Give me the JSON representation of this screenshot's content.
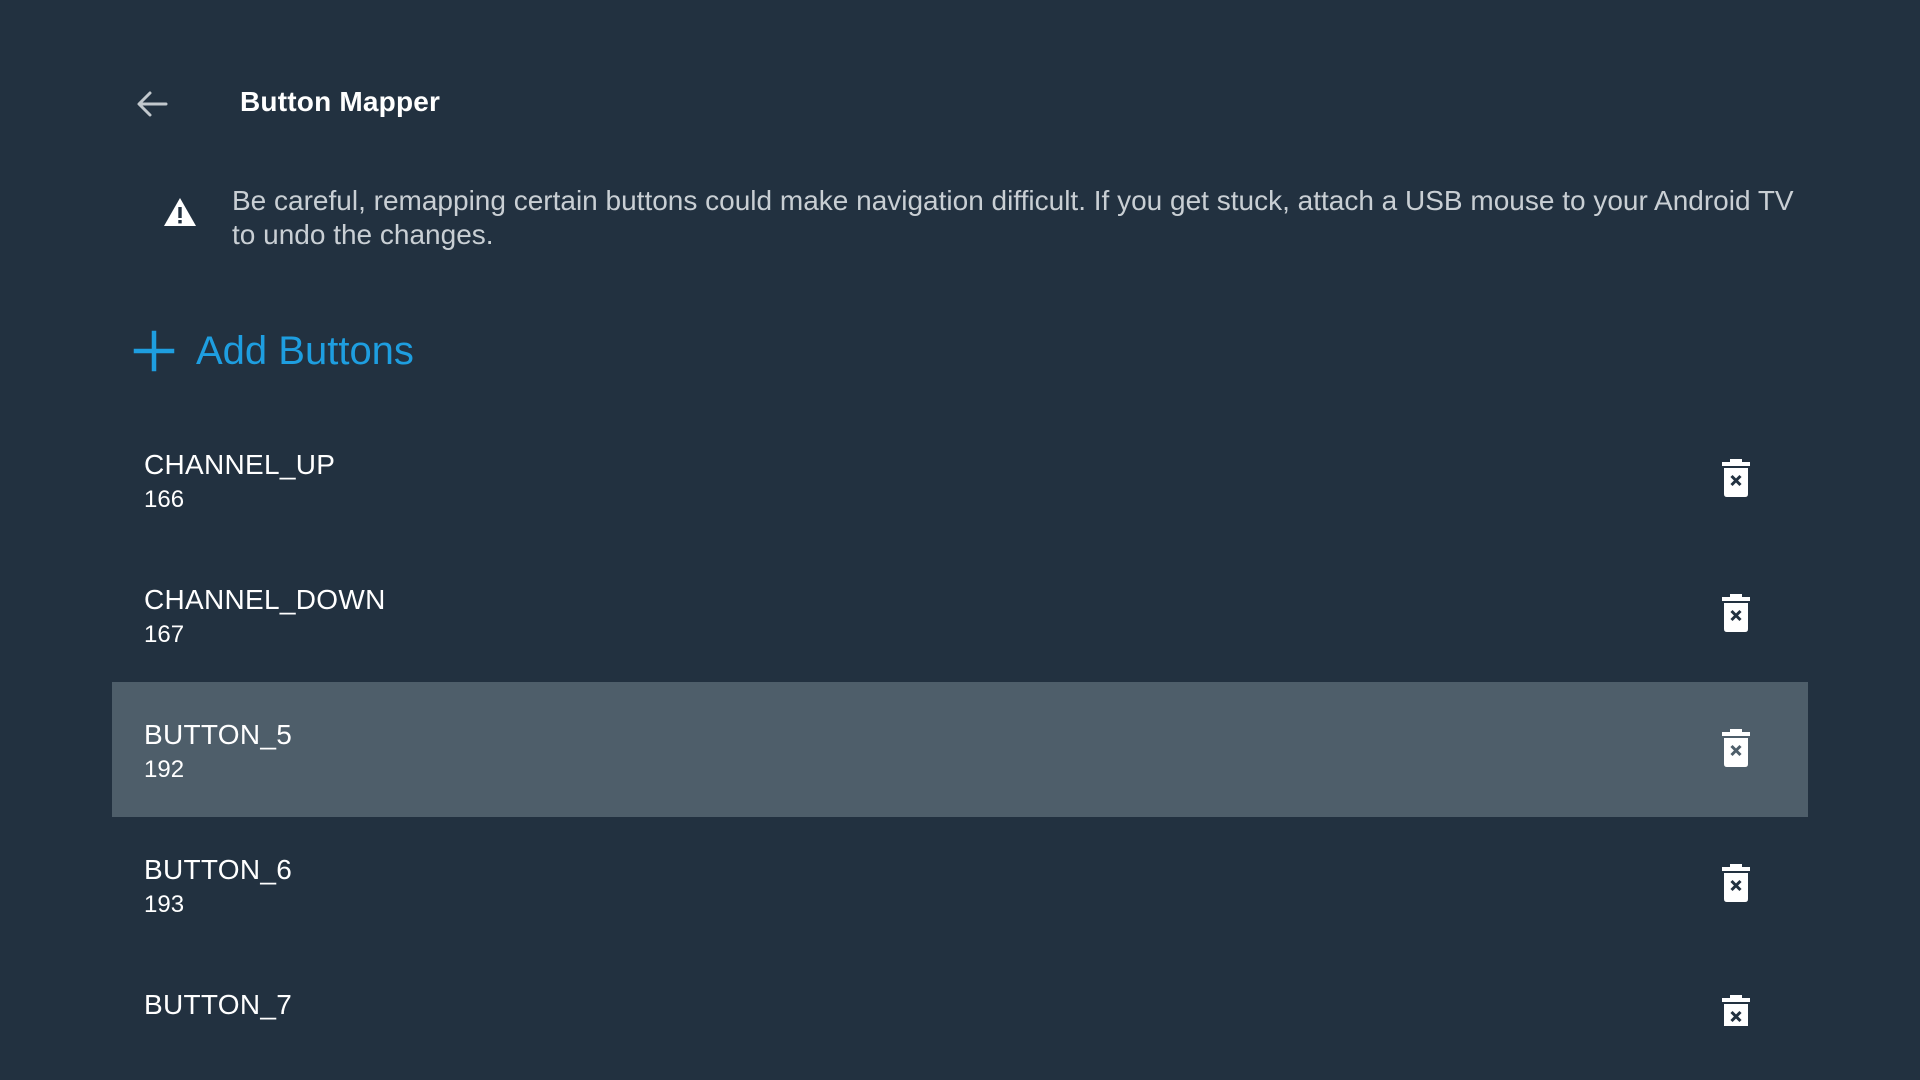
{
  "header": {
    "back_icon": "arrow-back-icon",
    "title": "Button Mapper"
  },
  "warning": {
    "icon": "warning-triangle-icon",
    "text": "Be careful, remapping certain buttons could make navigation difficult. If you get stuck, attach a USB mouse to your Android TV to undo the changes."
  },
  "add_buttons": {
    "icon": "plus-icon",
    "label": "Add Buttons",
    "color": "#1e9ee0"
  },
  "colors": {
    "background": "#223140",
    "selected_row": "#4e5e6a"
  },
  "buttons": [
    {
      "name": "CHANNEL_UP",
      "code": "166",
      "selected": false,
      "delete_icon": "delete-forever-icon"
    },
    {
      "name": "CHANNEL_DOWN",
      "code": "167",
      "selected": false,
      "delete_icon": "delete-forever-icon"
    },
    {
      "name": "BUTTON_5",
      "code": "192",
      "selected": true,
      "delete_icon": "delete-forever-icon"
    },
    {
      "name": "BUTTON_6",
      "code": "193",
      "selected": false,
      "delete_icon": "delete-forever-icon"
    },
    {
      "name": "BUTTON_7",
      "code": "",
      "selected": false,
      "delete_icon": "delete-forever-icon"
    }
  ]
}
